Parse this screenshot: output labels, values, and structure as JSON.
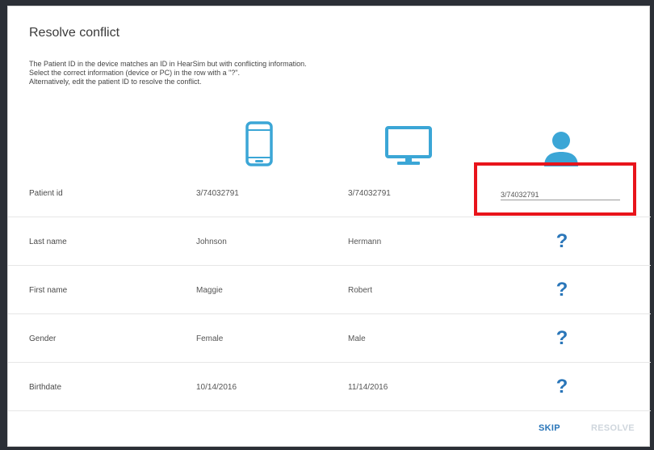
{
  "dialog": {
    "title": "Resolve conflict",
    "description": [
      "The Patient ID in the device matches an ID in HearSim but with conflicting information.",
      "Select the correct information (device or PC) in the row with a \"?\".",
      "Alternatively, edit the patient ID to resolve the conflict."
    ]
  },
  "columns": {
    "device_icon": "phone-icon",
    "pc_icon": "monitor-icon",
    "patient_icon": "person-icon"
  },
  "rows": [
    {
      "label": "Patient id",
      "device": "3/74032791",
      "pc": "3/74032791",
      "resolved": "3/74032791"
    },
    {
      "label": "Last name",
      "device": "Johnson",
      "pc": "Hermann",
      "resolved": "?"
    },
    {
      "label": "First name",
      "device": "Maggie",
      "pc": "Robert",
      "resolved": "?"
    },
    {
      "label": "Gender",
      "device": "Female",
      "pc": "Male",
      "resolved": "?"
    },
    {
      "label": "Birthdate",
      "device": "10/14/2016",
      "pc": "11/14/2016",
      "resolved": "?"
    }
  ],
  "actions": {
    "skip": "SKIP",
    "resolve": "RESOLVE"
  },
  "colors": {
    "accent": "#2a76b9",
    "icon": "#3ba6d6",
    "highlight": "#e8141b",
    "disabled": "#cfd6dd"
  }
}
